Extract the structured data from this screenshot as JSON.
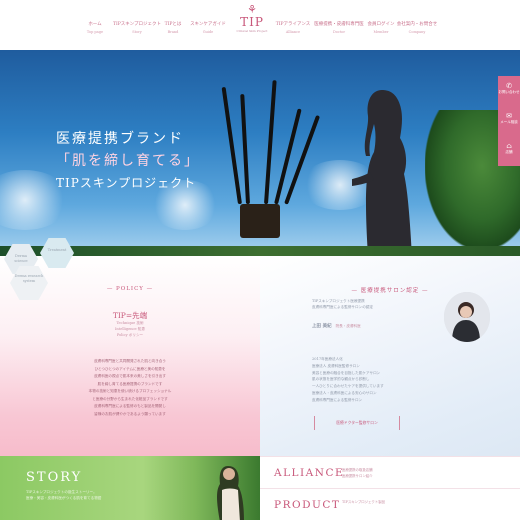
{
  "nav": {
    "items": [
      {
        "label": "ホーム",
        "sub": "Top page"
      },
      {
        "label": "TIPスキンプロジェクト",
        "sub": "Story"
      },
      {
        "label": "TIPとは",
        "sub": "Brand"
      },
      {
        "label": "スキンケアガイド",
        "sub": "Guide"
      },
      {
        "label": "TIPアライアンス",
        "sub": "Alliance"
      },
      {
        "label": "医療提携・皮膚科専門医",
        "sub": "Doctor"
      },
      {
        "label": "会員ログイン",
        "sub": "Member"
      },
      {
        "label": "会社案内・お問合せ",
        "sub": "Company"
      }
    ]
  },
  "logo": {
    "mark": "⚘",
    "text": "TIP",
    "sub": "Clinical Skin Project"
  },
  "hero": {
    "line1": "医療提携ブランド",
    "line2": "「肌を締し育てる」",
    "line3": "TIPスキンプロジェクト"
  },
  "side_tabs": [
    {
      "icon": "✆",
      "label": "お問い合わせ"
    },
    {
      "icon": "✉",
      "label": "メール相談"
    },
    {
      "icon": "⌂",
      "label": "店舗"
    }
  ],
  "hexes": [
    {
      "label": "Derma science"
    },
    {
      "label": "Treatment"
    },
    {
      "label": "Derma research system"
    }
  ],
  "policy": {
    "heading": "— POLICY —",
    "main": "TIP=先端",
    "sub": [
      "Technique 技術",
      "Intelligence 知恵",
      "Policy ポリシー"
    ],
    "body": [
      "皮膚科専門医と共同開発された肌と向き合う",
      "ひとつひとつのアイテムに医療と美の知恵を",
      "皮膚科医の視点で肌本来の美しさを引き出す",
      "肌を締し育てる医療提携のブランドです",
      "本物の技術と知恵を使い続けるプロフェッショナル",
      "と医療の分野から生まれた化粧品ブランドです",
      "皮膚科専門医による監修のもと製品を開発し",
      "皆様のお肌が健やかであるよう願っています"
    ]
  },
  "salon": {
    "heading": "— 医療提携サロン認定 —",
    "intro": [
      "TIPスキンプロジェクト医療提携",
      "皮膚科専門医による監修サロンの認定"
    ],
    "name": "上田 美紀",
    "name_role": "院長・皮膚科医",
    "body": [
      "2017年医療法人化",
      "医療法人 皮膚科医監修サロン",
      "美容と医療の融合を目指した肌ケアサロン",
      "肌の状態を医学的な観点から診断し",
      "一人ひとりに合わせたケアを提供しています",
      "医療法人・皮膚科医による安心のサロン",
      "皮膚科専門医による監修サロン"
    ],
    "button": "医療ドクター監修サロン"
  },
  "story": {
    "title": "STORY",
    "text": [
      "TIPスキンプロジェクトの誕生ストーリー。",
      "医療・美容・皮膚科医がつくる肌を育てる物語"
    ]
  },
  "alliance": {
    "title": "ALLIANCE",
    "text": [
      "医療提携の取扱店舗",
      "医療提携サロン紹介"
    ]
  },
  "product": {
    "title": "PRODUCT",
    "text": [
      "TIPスキンプロジェクト製品"
    ]
  }
}
